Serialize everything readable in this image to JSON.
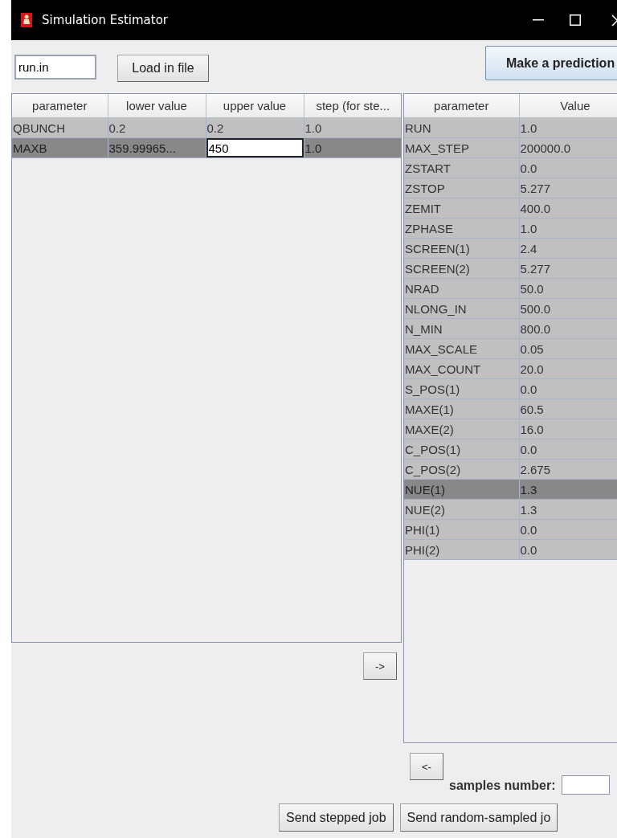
{
  "window": {
    "title": "Simulation Estimator"
  },
  "file_field": {
    "value": "run.in"
  },
  "load_button": "Load in file",
  "predict_button": "Make a prediction",
  "range_table": {
    "columns": [
      "parameter",
      "lower value",
      "upper value",
      "step (for ste..."
    ],
    "rows": [
      {
        "selected": false,
        "cells": [
          {
            "kind": "text",
            "text": "QBUNCH"
          },
          {
            "kind": "text",
            "text": "0.2"
          },
          {
            "kind": "text",
            "text": "0.2"
          },
          {
            "kind": "text",
            "text": "1.0"
          }
        ]
      },
      {
        "selected": true,
        "cells": [
          {
            "kind": "text",
            "text": "MAXB"
          },
          {
            "kind": "text",
            "text": "359.99965..."
          },
          {
            "kind": "input",
            "text": "450"
          },
          {
            "kind": "text",
            "text": "1.0"
          }
        ]
      }
    ]
  },
  "add_button": "->",
  "parameter_table": {
    "columns": [
      "parameter",
      "Value"
    ],
    "rows": [
      {
        "name": "RUN",
        "value": "1.0",
        "selected": false
      },
      {
        "name": "MAX_STEP",
        "value": "200000.0",
        "selected": false
      },
      {
        "name": "ZSTART",
        "value": "0.0",
        "selected": false
      },
      {
        "name": "ZSTOP",
        "value": "5.277",
        "selected": false
      },
      {
        "name": "ZEMIT",
        "value": "400.0",
        "selected": false
      },
      {
        "name": "ZPHASE",
        "value": "1.0",
        "selected": false
      },
      {
        "name": "SCREEN(1)",
        "value": "2.4",
        "selected": false
      },
      {
        "name": "SCREEN(2)",
        "value": "5.277",
        "selected": false
      },
      {
        "name": "NRAD",
        "value": "50.0",
        "selected": false
      },
      {
        "name": "NLONG_IN",
        "value": "500.0",
        "selected": false
      },
      {
        "name": "N_MIN",
        "value": "800.0",
        "selected": false
      },
      {
        "name": "MAX_SCALE",
        "value": "0.05",
        "selected": false
      },
      {
        "name": "MAX_COUNT",
        "value": "20.0",
        "selected": false
      },
      {
        "name": "S_POS(1)",
        "value": "0.0",
        "selected": false
      },
      {
        "name": "MAXE(1)",
        "value": "60.5",
        "selected": false
      },
      {
        "name": "MAXE(2)",
        "value": "16.0",
        "selected": false
      },
      {
        "name": "C_POS(1)",
        "value": "0.0",
        "selected": false
      },
      {
        "name": "C_POS(2)",
        "value": "2.675",
        "selected": false
      },
      {
        "name": "NUE(1)",
        "value": "1.3",
        "selected": true
      },
      {
        "name": "NUE(2)",
        "value": "1.3",
        "selected": false
      },
      {
        "name": "PHI(1)",
        "value": "0.0",
        "selected": false
      },
      {
        "name": "PHI(2)",
        "value": "0.0",
        "selected": false
      }
    ]
  },
  "remove_button": "<-",
  "samples": {
    "label": "samples number:"
  },
  "job_buttons": [
    "Send stepped job",
    "Send random-sampled jo"
  ]
}
